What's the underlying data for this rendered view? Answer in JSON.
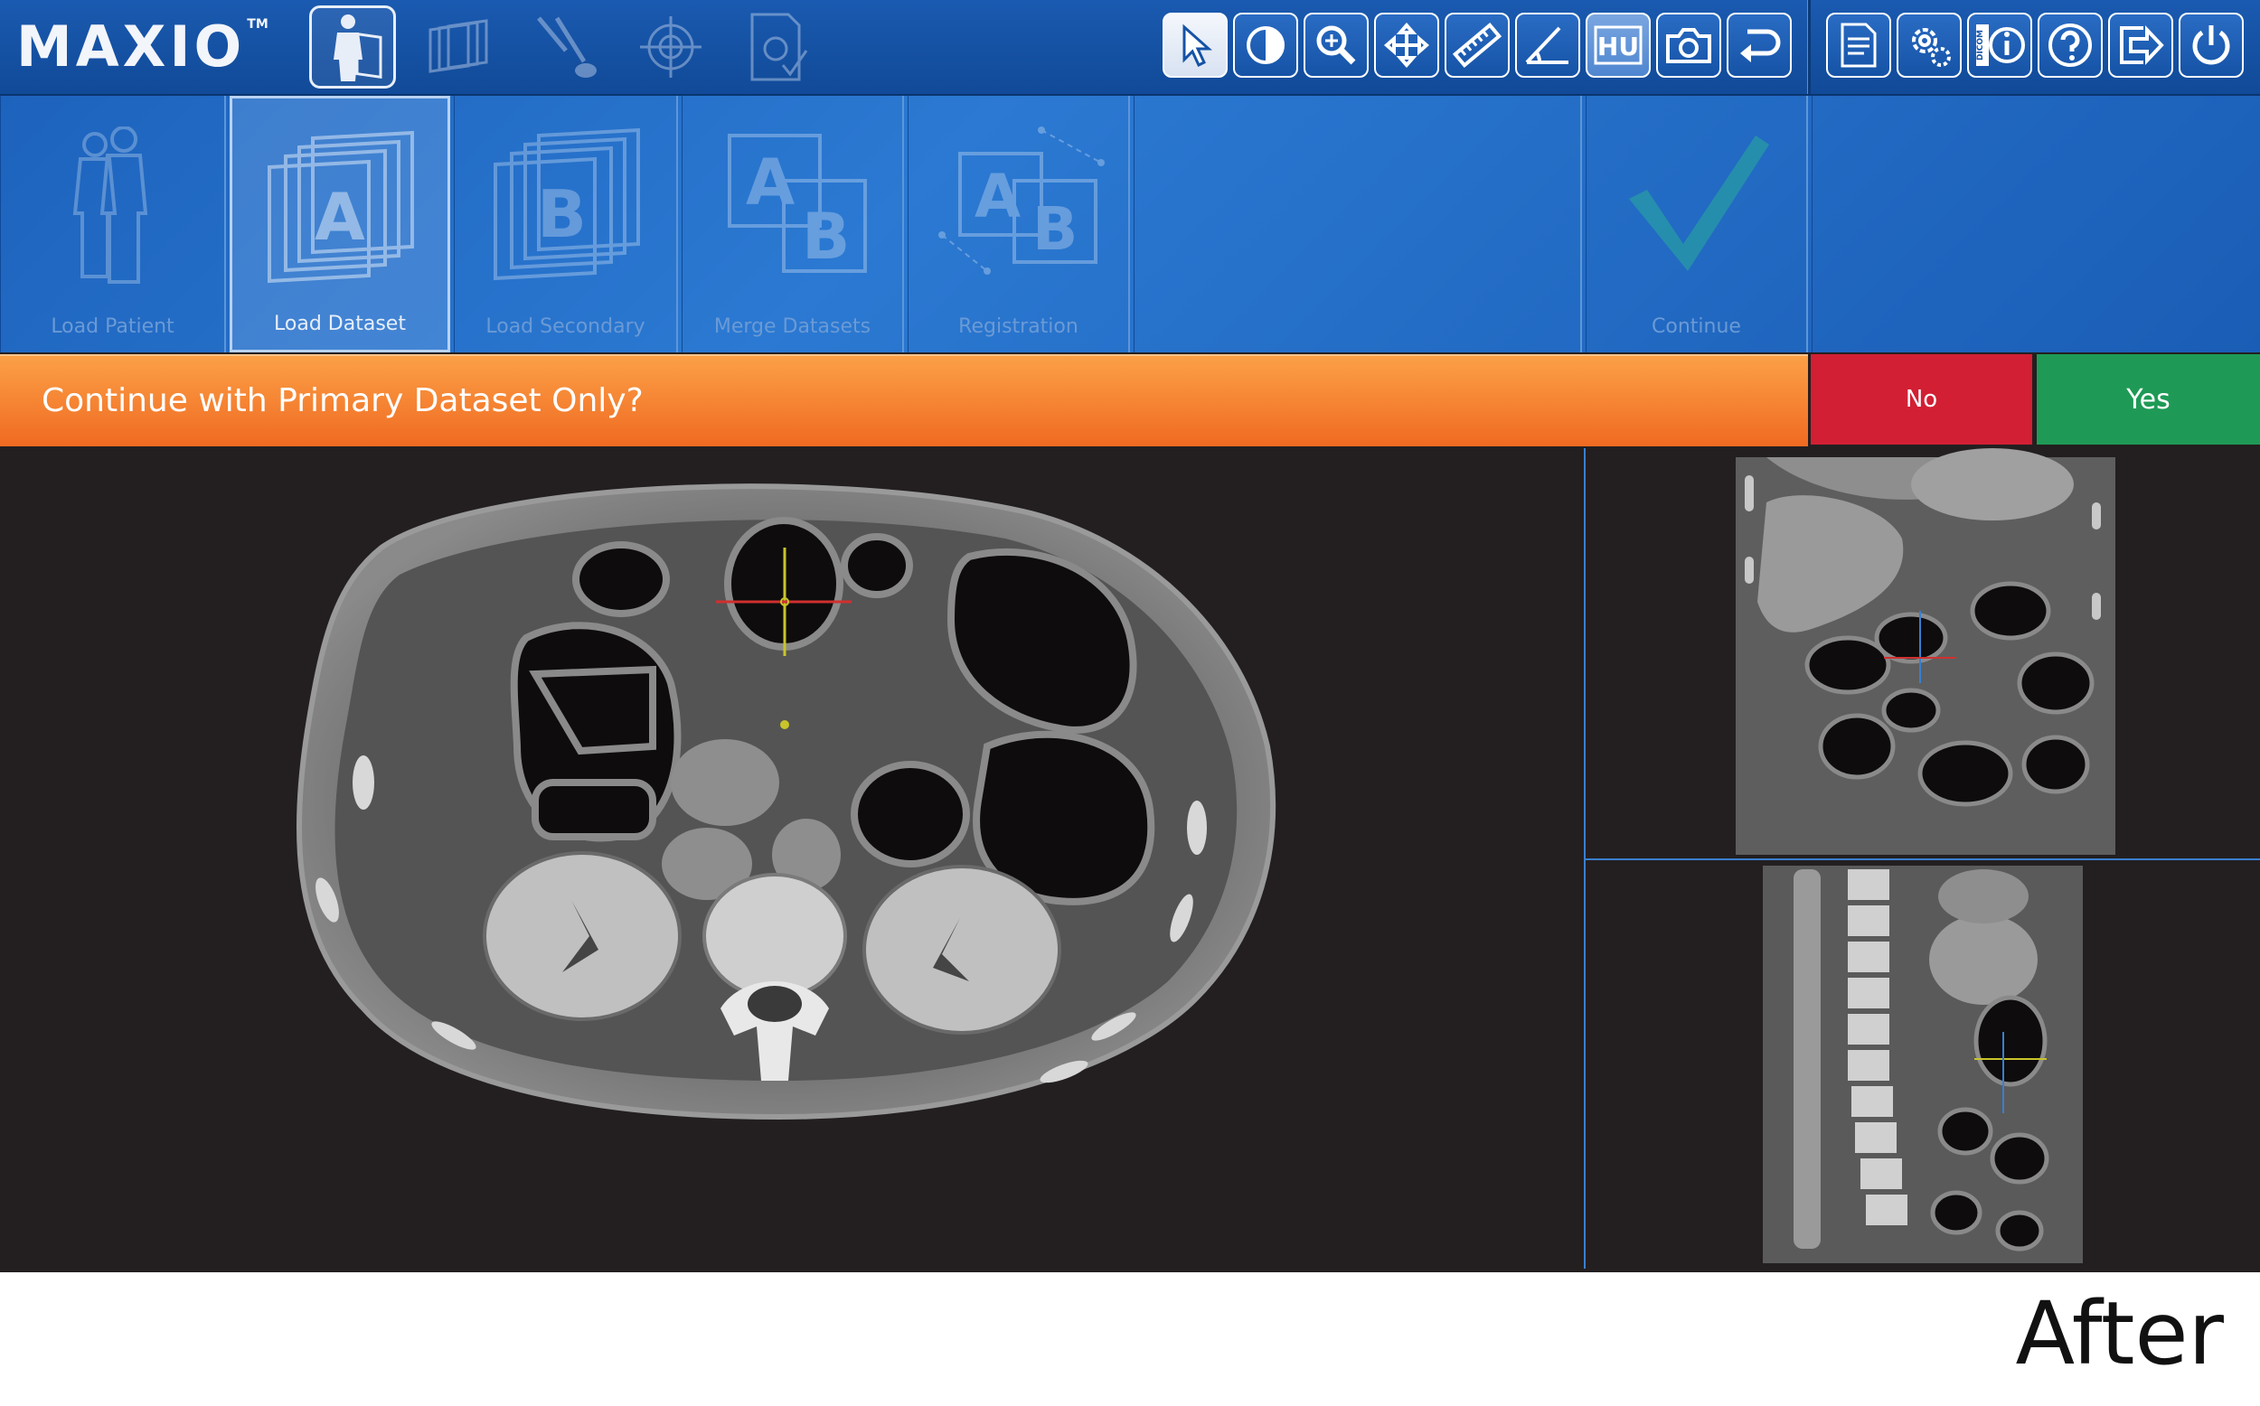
{
  "brand": {
    "name": "MAXIO",
    "trademark": "TM"
  },
  "workflow_tabs": [
    {
      "icon": "patient-icon",
      "active": true
    },
    {
      "icon": "volume-icon",
      "active": false
    },
    {
      "icon": "instruments-icon",
      "active": false
    },
    {
      "icon": "target-icon",
      "active": false
    },
    {
      "icon": "plan-check-icon",
      "active": false
    }
  ],
  "tools": [
    {
      "icon": "pointer-icon",
      "selected": true
    },
    {
      "icon": "contrast-icon"
    },
    {
      "icon": "zoom-icon"
    },
    {
      "icon": "pan-icon"
    },
    {
      "icon": "ruler-icon"
    },
    {
      "icon": "angle-icon"
    },
    {
      "icon": "hu-icon",
      "label": "HU"
    },
    {
      "icon": "camera-icon"
    },
    {
      "icon": "undo-icon"
    }
  ],
  "system_tools": [
    {
      "icon": "report-icon"
    },
    {
      "icon": "settings-icon"
    },
    {
      "icon": "dicom-info-icon",
      "label": "DICOM"
    },
    {
      "icon": "help-icon"
    },
    {
      "icon": "export-icon"
    },
    {
      "icon": "power-icon"
    }
  ],
  "steps": [
    {
      "label": "Load Patient",
      "active": false
    },
    {
      "label": "Load Dataset",
      "active": true,
      "letter": "A"
    },
    {
      "label": "Load Secondary",
      "active": false,
      "letter": "B"
    },
    {
      "label": "Merge Datasets",
      "active": false,
      "letters": [
        "A",
        "B"
      ]
    },
    {
      "label": "Registration",
      "active": false,
      "letters": [
        "A",
        "B"
      ]
    },
    {
      "label": "Continue",
      "active": false
    }
  ],
  "prompt": {
    "question": "Continue with Primary Dataset Only?",
    "no_label": "No",
    "yes_label": "Yes"
  },
  "colors": {
    "toolbar": "#1a5ab0",
    "prompt_orange": "#f48a34",
    "no_red": "#d21f34",
    "yes_green": "#1e9a56",
    "viewport_bg": "#231f20"
  },
  "caption": "After"
}
